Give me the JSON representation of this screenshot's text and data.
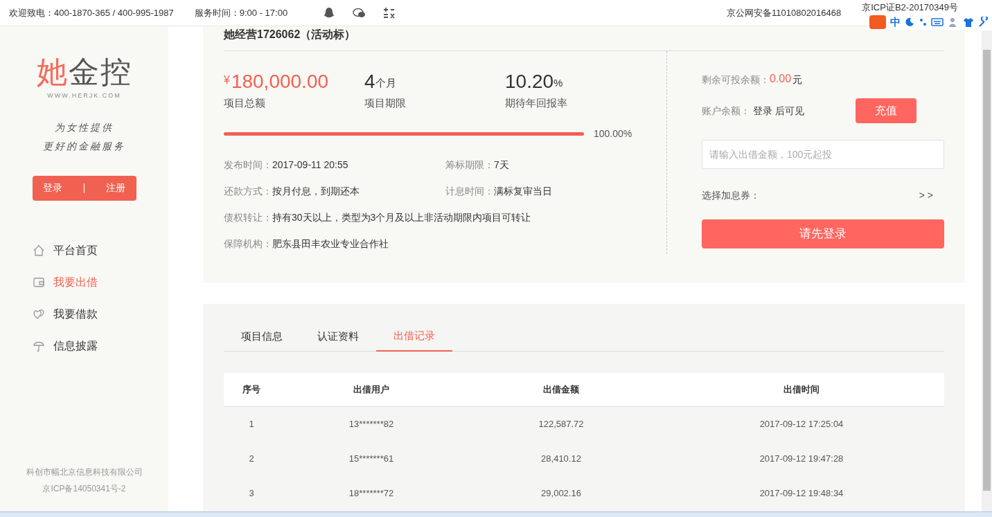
{
  "top_bar": {
    "hotline": "欢迎致电：400-1870-365 / 400-995-1987",
    "hours": "服务时间：9:00 - 17:00",
    "record": "京公网安备11010802016468",
    "icp": "京ICP证B2-20170349号"
  },
  "ime_toolbar": {
    "mode": "中"
  },
  "sidebar": {
    "logo_red": "她",
    "logo_dark": "金控",
    "logo_url": "WWW.HERJK.COM",
    "slogan": [
      "为女性提供",
      "更好的金融服务"
    ],
    "login": "登录",
    "register": "注册",
    "nav": [
      {
        "label": "平台首页",
        "selected": false
      },
      {
        "label": "我要出借",
        "selected": true
      },
      {
        "label": "我要借款",
        "selected": false
      },
      {
        "label": "信息披露",
        "selected": false
      }
    ],
    "footer": [
      "科创市幅北京信息科技有限公司",
      "京ICP备14050341号-2"
    ]
  },
  "project": {
    "title": "她经营1726062（活动标）",
    "stats": [
      {
        "prefix": "¥",
        "value": "180,000.00",
        "label": "项目总额",
        "kind": "money"
      },
      {
        "value": "4",
        "unit": "个月",
        "label": "项目期限",
        "kind": "plain"
      },
      {
        "value": "10.20",
        "unit": "%",
        "label": "期待年回报率",
        "kind": "plain"
      }
    ],
    "progress": {
      "level": 1,
      "reading": "100.00%"
    },
    "detail_rows": [
      [
        {
          "label": "发布时间：",
          "value": "2017-09-11 20:55"
        },
        {
          "label": "筹标期限：",
          "value": "7天"
        }
      ],
      [
        {
          "label": "还款方式：",
          "value": "按月付息，到期还本"
        },
        {
          "label": "计息时间：",
          "value": "满标复审当日"
        }
      ],
      [
        {
          "label": "债权转让：",
          "value": "持有30天以上，类型为3个月及以上非活动期限内项目可转让"
        }
      ],
      [
        {
          "label": "保障机构：",
          "value": "肥东县田丰农业专业合作社"
        }
      ]
    ],
    "remaining_label": "剩余可投余额：",
    "remaining_value": "0.00",
    "remaining_unit": "元",
    "balance_label": "账户余额：",
    "balance_value": "登录 后可见",
    "recharge": "充值",
    "amount_placeholder": "请输入出借金额，100元起投",
    "coupon_label": "选择加息券：",
    "coupon_arrow": "> >",
    "submit": "请先登录"
  },
  "tabs": [
    {
      "label": "项目信息",
      "selected": false
    },
    {
      "label": "认证资料",
      "selected": false
    },
    {
      "label": "出借记录",
      "selected": true
    }
  ],
  "table": {
    "columns": [
      "序号",
      "出借用户",
      "出借金额",
      "出借时间"
    ],
    "rows": [
      [
        "1",
        "13*******82",
        "122,587.72",
        "2017-09-12 17:25:04"
      ],
      [
        "2",
        "15*******61",
        "28,410.12",
        "2017-09-12 19:47:28"
      ],
      [
        "3",
        "18*******72",
        "29,002.16",
        "2017-09-12 19:48:34"
      ]
    ]
  }
}
